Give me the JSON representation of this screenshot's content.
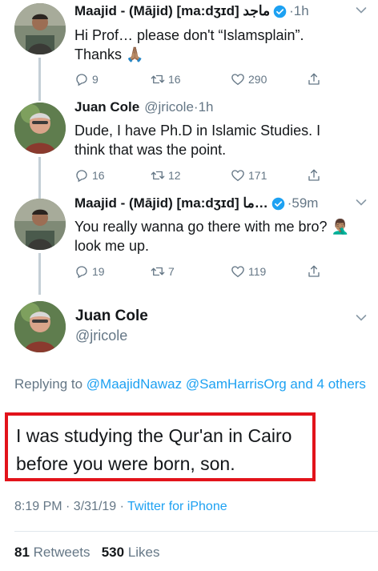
{
  "thread": [
    {
      "name": "Maajid - (Mājid) [ma:dʒɪd] ماجد",
      "handle": "",
      "verified": true,
      "time": "1h",
      "text_lines": [
        "Hi Prof… please don't “Islamsplain”.",
        "Thanks 🙏🏽"
      ],
      "replies": "9",
      "retweets": "16",
      "likes": "290"
    },
    {
      "name": "Juan Cole",
      "handle": "@jricole",
      "verified": false,
      "time": "1h",
      "text_lines": [
        "Dude, I have  Ph.D in Islamic Studies.  I",
        "think that was the point."
      ],
      "replies": "16",
      "retweets": "12",
      "likes": "171"
    },
    {
      "name": "Maajid - (Mājid) [ma:dʒɪd] ما…",
      "handle": "",
      "verified": true,
      "time": "59m",
      "text_lines": [
        "You really wanna go there with me bro? 🤦🏽‍♂️",
        "look me up."
      ],
      "replies": "19",
      "retweets": "7",
      "likes": "119"
    }
  ],
  "main_tweet": {
    "name": "Juan Cole",
    "handle": "@jricole",
    "replying_prefix": "Replying to",
    "replying_to": "@MaajidNawaz @SamHarrisOrg and 4 others",
    "text_lines": [
      "I was studying the Qur'an in Cairo",
      "before you were born, son."
    ],
    "timestamp": "8:19 PM · 3/31/19 · ",
    "source": "Twitter for iPhone",
    "retweets_count": "81",
    "retweets_label": "Retweets",
    "likes_count": "530",
    "likes_label": "Likes"
  },
  "colors": {
    "accent": "#1da1f2",
    "muted": "#657786",
    "highlight_border": "#e2131b"
  },
  "icons": [
    "reply-icon",
    "retweet-icon",
    "like-icon",
    "share-icon",
    "verified-icon",
    "chevron-down-icon"
  ]
}
